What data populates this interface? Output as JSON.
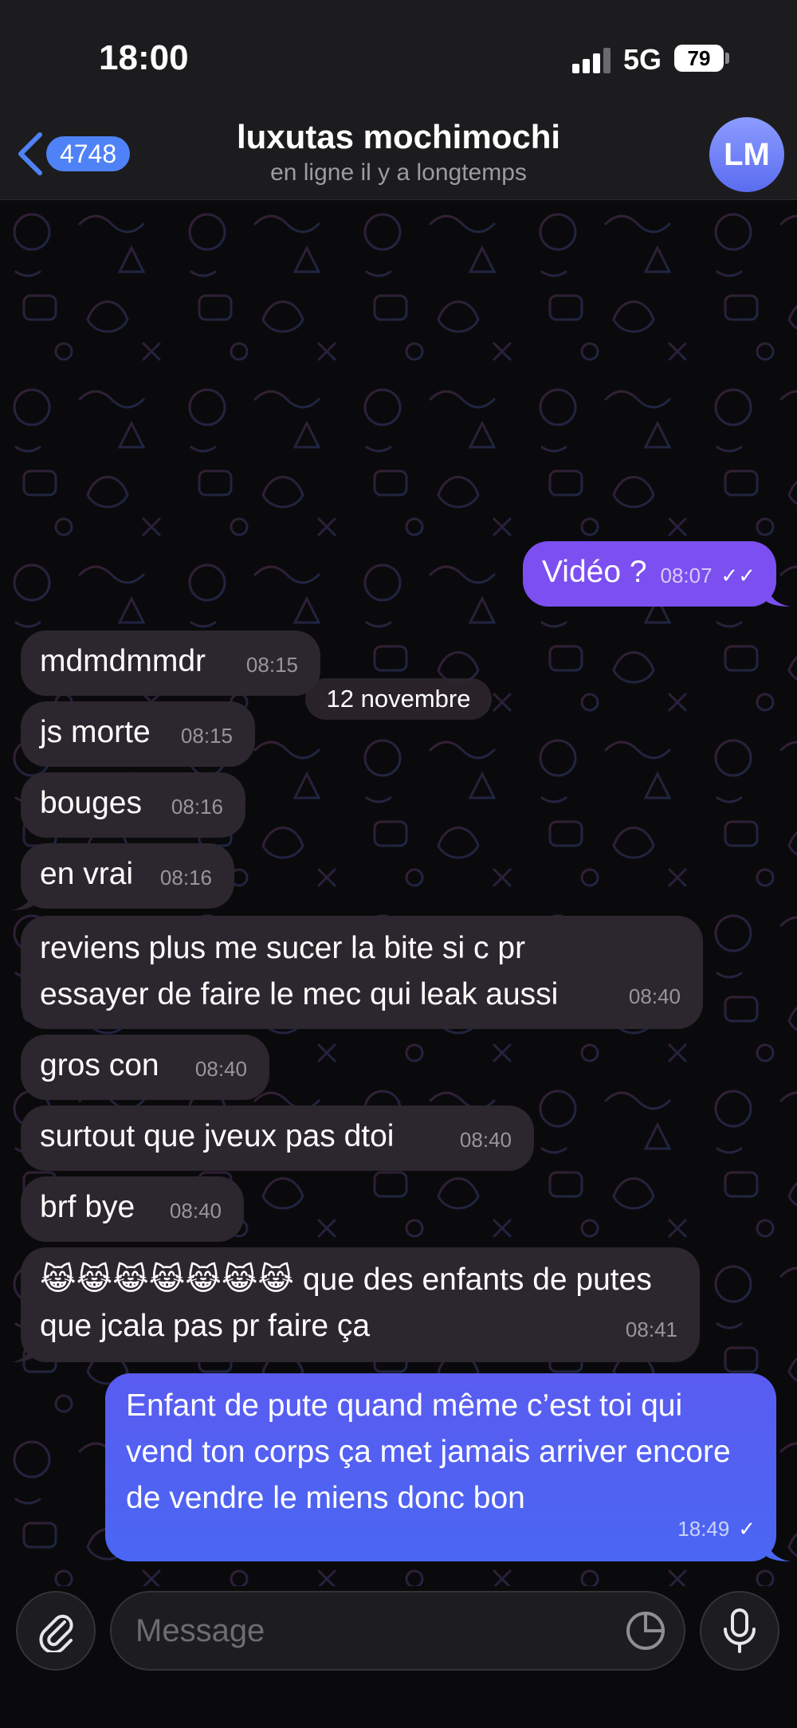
{
  "status_bar": {
    "time": "18:00",
    "network": "5G",
    "battery": "79"
  },
  "header": {
    "back_count": "4748",
    "title": "luxutas mochimochi",
    "subtitle": "en ligne il y a longtemps",
    "avatar_initials": "LM"
  },
  "chat": {
    "date_separator": "12 novembre",
    "messages": [
      {
        "direction": "outgoing",
        "text": "Vidéo ?",
        "time": "08:07",
        "status": "read"
      },
      {
        "direction": "incoming",
        "text": "mdmdmmdr",
        "time": "08:15"
      },
      {
        "direction": "incoming",
        "text": "js morte",
        "time": "08:15"
      },
      {
        "direction": "incoming",
        "text": "bouges",
        "time": "08:16"
      },
      {
        "direction": "incoming",
        "text": "en vrai",
        "time": "08:16"
      },
      {
        "direction": "incoming",
        "text": "reviens plus me sucer la bite si c pr essayer de faire le mec qui leak aussi",
        "time": "08:40"
      },
      {
        "direction": "incoming",
        "text": "gros con",
        "time": "08:40"
      },
      {
        "direction": "incoming",
        "text": "surtout que jveux pas dtoi",
        "time": "08:40"
      },
      {
        "direction": "incoming",
        "text": "brf bye",
        "time": "08:40"
      },
      {
        "direction": "incoming",
        "text": "😹😹😹😹😹😹😹 que des enfants de putes que jcala pas pr faire ça",
        "time": "08:41"
      },
      {
        "direction": "outgoing",
        "text": "Enfant de pute quand même c’est toi qui vend ton corps ça met jamais arriver encore de vendre le miens donc bon",
        "time": "18:49",
        "status": "sent"
      }
    ]
  },
  "composer": {
    "placeholder": "Message"
  },
  "icons": {
    "back": "chevron-left-icon",
    "attach": "paperclip-icon",
    "sticker": "sticker-icon",
    "mic": "microphone-icon"
  },
  "colors": {
    "accent": "#4f82f7",
    "outgoing_top": "#7c4ff0",
    "outgoing_bottom": "#4a63f2",
    "incoming": "#2c262e"
  }
}
